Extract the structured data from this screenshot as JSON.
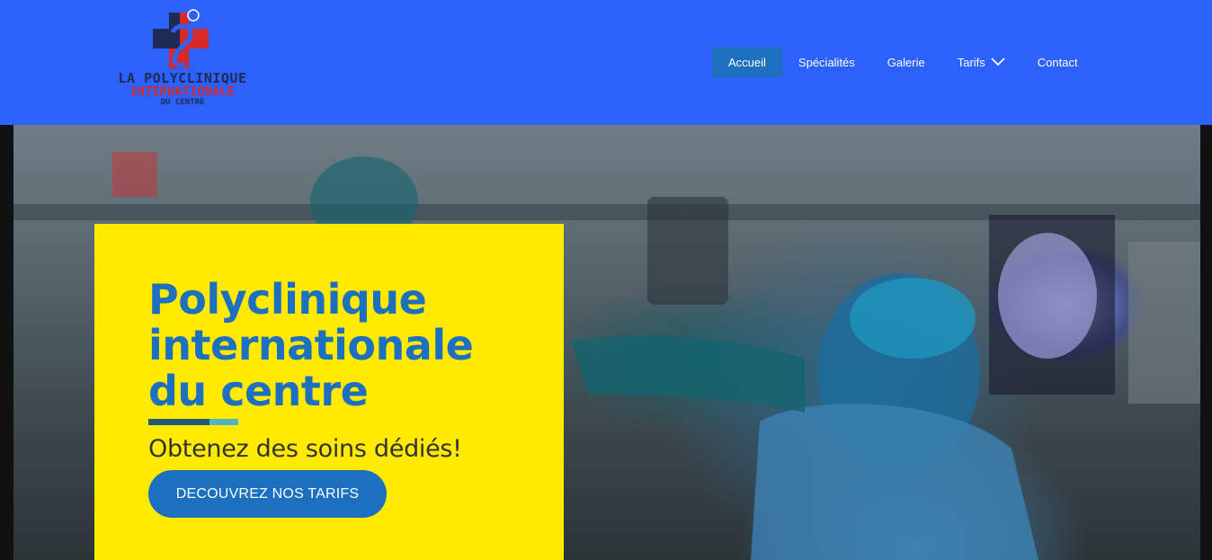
{
  "brand": {
    "line1": "LA POLYCLINIQUE",
    "line2": "INTERNATIONALE",
    "line3": "DU CENTRE",
    "colors": {
      "navy": "#1f2a55",
      "red": "#d62a2a",
      "header": "#2c61fb"
    }
  },
  "nav": {
    "items": [
      {
        "label": "Accueil",
        "active": true
      },
      {
        "label": "Spécialités"
      },
      {
        "label": "Galerie"
      },
      {
        "label": "Tarifs",
        "icon": "chevron-down-icon"
      },
      {
        "label": "Contact"
      }
    ]
  },
  "hero": {
    "title": "Polyclinique internationale du centre",
    "subtitle": "Obtenez des soins dédiés!",
    "cta_label": "DECOUVREZ NOS TARIFS",
    "colors": {
      "card": "#ffea00",
      "title": "#1d6fc0",
      "cta": "#1d6fc0"
    }
  }
}
